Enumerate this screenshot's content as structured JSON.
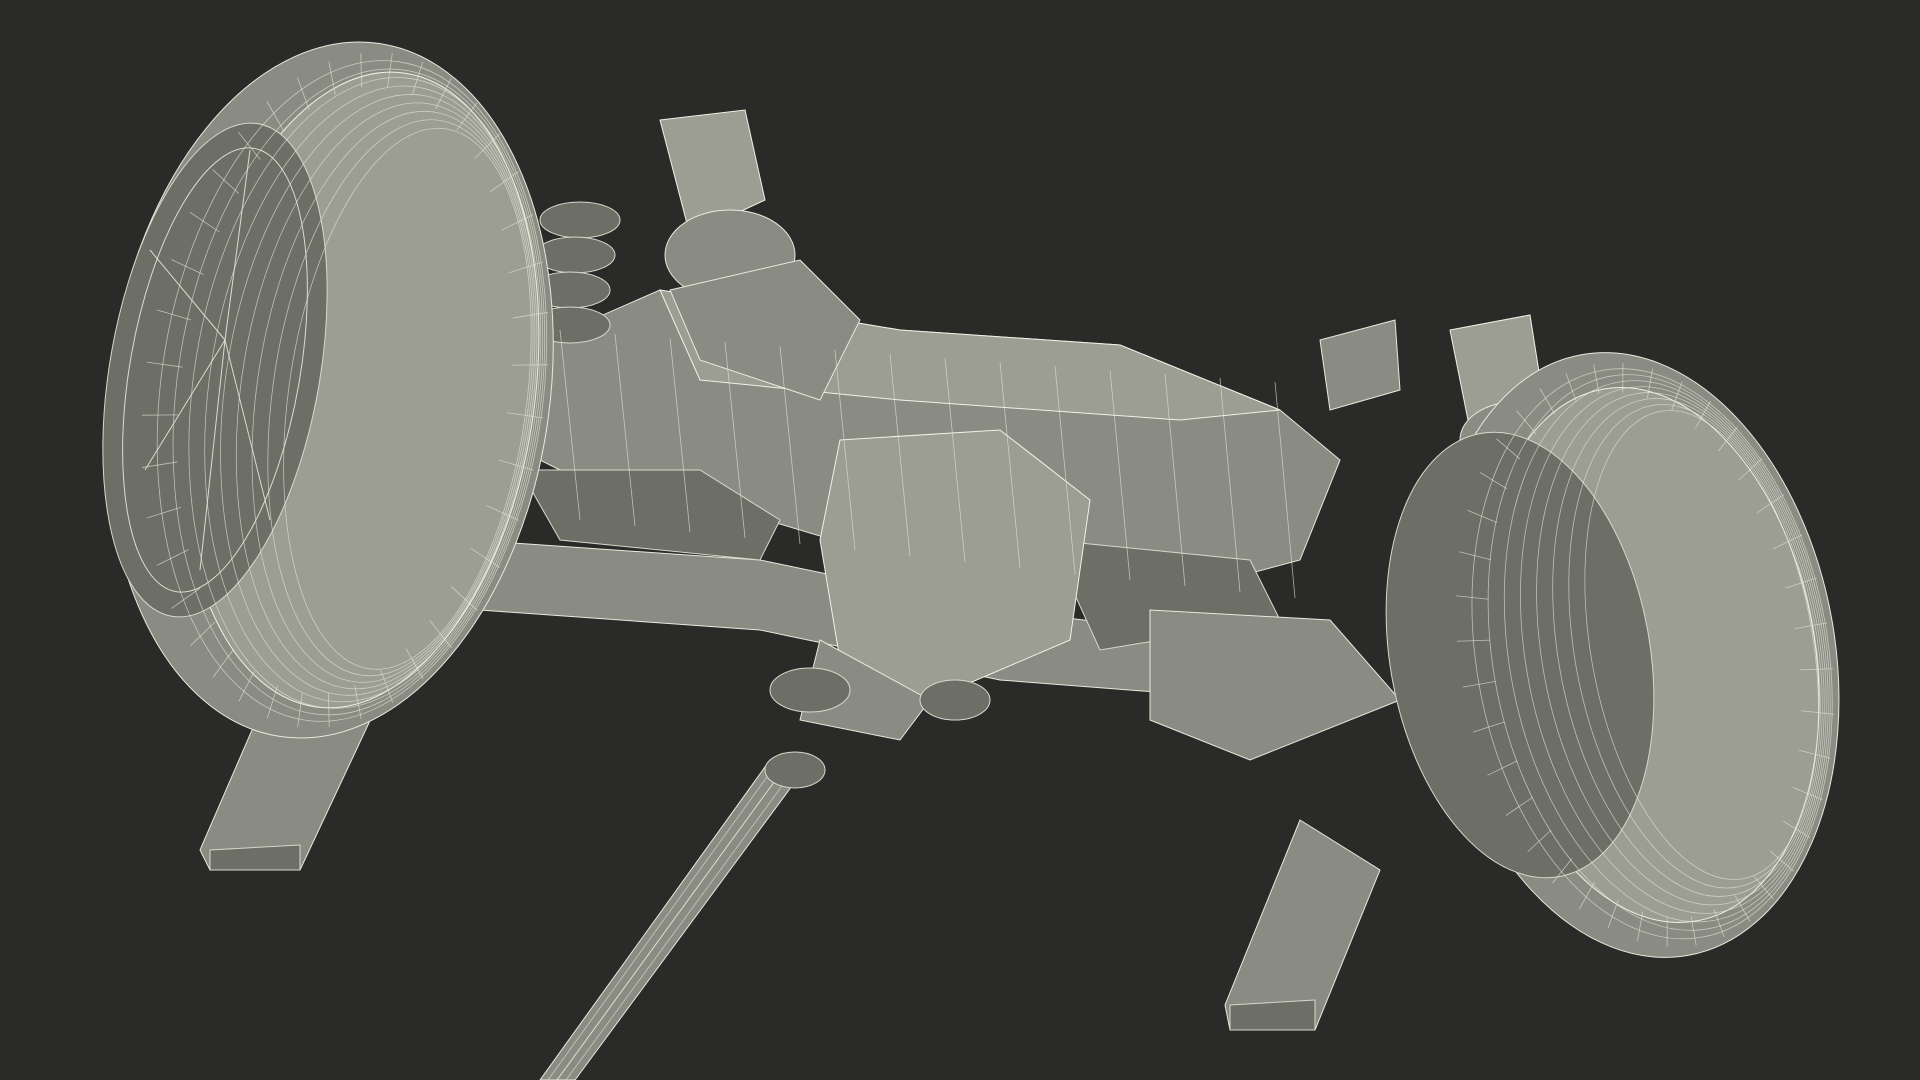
{
  "scene": {
    "subject": "rear-axle-suspension-wireframe",
    "background_color": "#2a2a29",
    "mesh_fill_color": "#8a8b82",
    "wire_color": "#eef0de"
  }
}
